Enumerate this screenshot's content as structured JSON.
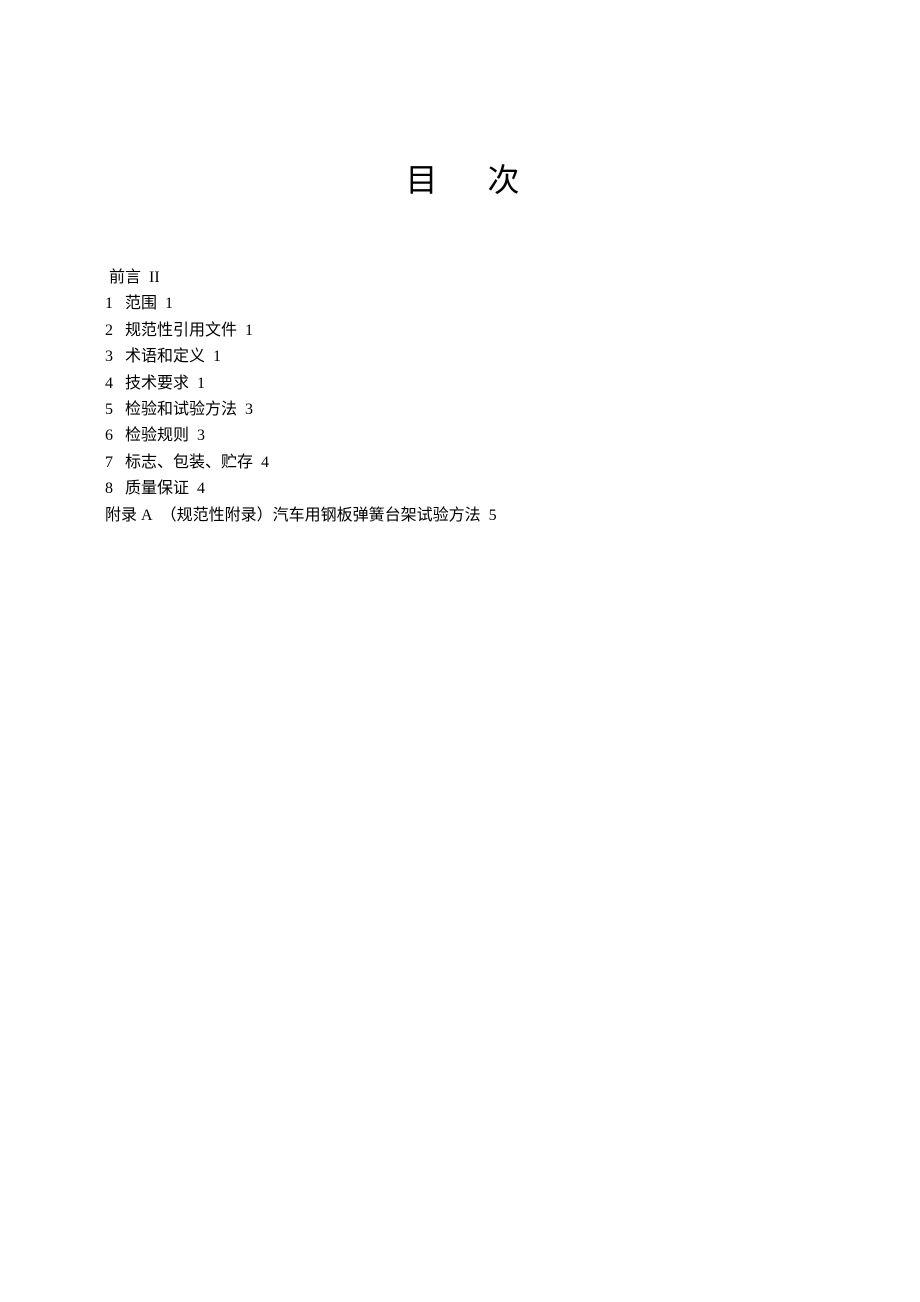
{
  "title": "目次",
  "toc": {
    "preface": {
      "label": "前言",
      "page": "II"
    },
    "items": [
      {
        "num": "1",
        "label": "范围",
        "page": "1"
      },
      {
        "num": "2",
        "label": "规范性引用文件",
        "page": "1"
      },
      {
        "num": "3",
        "label": "术语和定义",
        "page": "1"
      },
      {
        "num": "4",
        "label": "技术要求",
        "page": "1"
      },
      {
        "num": "5",
        "label": "检验和试验方法",
        "page": "3"
      },
      {
        "num": "6",
        "label": "检验规则",
        "page": "3"
      },
      {
        "num": "7",
        "label": "标志、包装、贮存",
        "page": "4"
      },
      {
        "num": "8",
        "label": "质量保证",
        "page": "4"
      }
    ],
    "appendix": {
      "num": "附录 A",
      "label": "（规范性附录）汽车用钢板弹簧台架试验方法",
      "page": "5"
    }
  }
}
